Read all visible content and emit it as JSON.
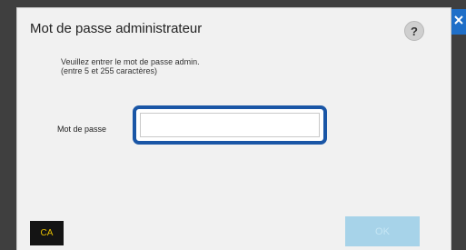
{
  "dialog": {
    "title": "Mot de passe administrateur",
    "help_label": "?",
    "close_icon": "close-icon"
  },
  "instructions": {
    "line1": "Veuillez entrer le mot de passe admin.",
    "line2": "(entre 5 et 255 caractères)"
  },
  "password": {
    "label": "Mot de passe",
    "value": "",
    "placeholder": ""
  },
  "buttons": {
    "ca_label": "CA",
    "ok_label": "OK",
    "ok_enabled": false
  },
  "colors": {
    "accent": "#1a56a6",
    "close_bg": "#1f6fc8",
    "ca_text": "#e8c000",
    "ok_disabled_bg": "#a7d3e9"
  }
}
